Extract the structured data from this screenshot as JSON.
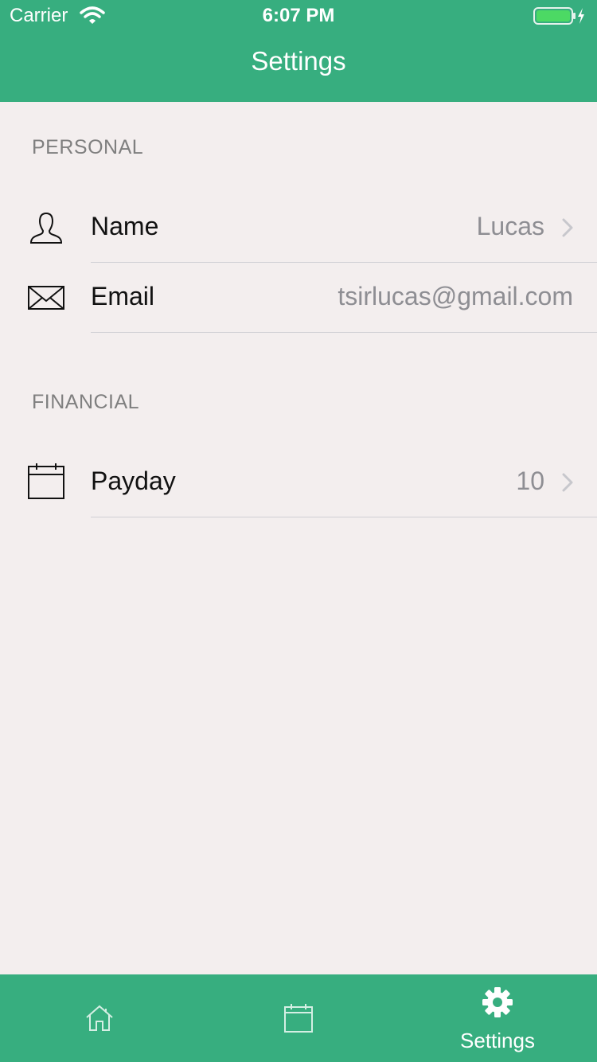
{
  "status_bar": {
    "carrier": "Carrier",
    "time": "6:07 PM",
    "battery_color": "#4cd964"
  },
  "nav": {
    "title": "Settings"
  },
  "sections": {
    "personal": {
      "header": "PERSONAL",
      "rows": {
        "name": {
          "label": "Name",
          "value": "Lucas",
          "icon": "person-icon"
        },
        "email": {
          "label": "Email",
          "value": "tsirlucas@gmail.com",
          "icon": "envelope-icon"
        }
      }
    },
    "financial": {
      "header": "FINANCIAL",
      "rows": {
        "payday": {
          "label": "Payday",
          "value": "10",
          "icon": "calendar-icon"
        }
      }
    }
  },
  "tabbar": {
    "tabs": [
      {
        "name": "home",
        "icon": "home-icon",
        "label": ""
      },
      {
        "name": "calendar",
        "icon": "calendar-icon",
        "label": ""
      },
      {
        "name": "settings",
        "icon": "gear-icon",
        "label": "Settings"
      }
    ]
  },
  "colors": {
    "primary": "#37ae7f",
    "background": "#f3eeee",
    "secondary_text": "#8e8e93",
    "header_text": "#7f7f7f"
  }
}
